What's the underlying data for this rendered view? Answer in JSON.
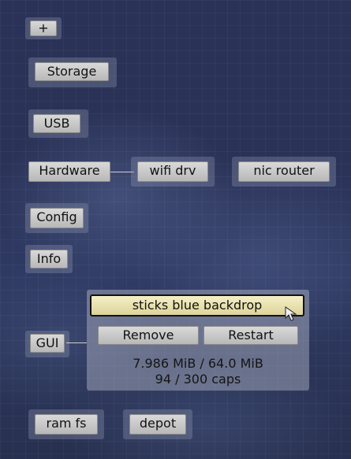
{
  "menu": {
    "add_label": "+",
    "storage_label": "Storage",
    "usb_label": "USB",
    "hardware_label": "Hardware",
    "wifi_drv_label": "wifi drv",
    "nic_router_label": "nic router",
    "config_label": "Config",
    "info_label": "Info",
    "gui_label": "GUI",
    "ram_fs_label": "ram fs",
    "depot_label": "depot"
  },
  "gui_panel": {
    "selected_item": "sticks blue backdrop",
    "remove_label": "Remove",
    "restart_label": "Restart",
    "ram_usage": "7.986 MiB / 64.0 MiB",
    "caps_usage": "94 / 300 caps"
  },
  "icons": {
    "cursor": "mouse-pointer-icon"
  },
  "colors": {
    "background": "#2a3257",
    "selected_item": "#e8dfa8",
    "button": "#c8c8c8"
  }
}
